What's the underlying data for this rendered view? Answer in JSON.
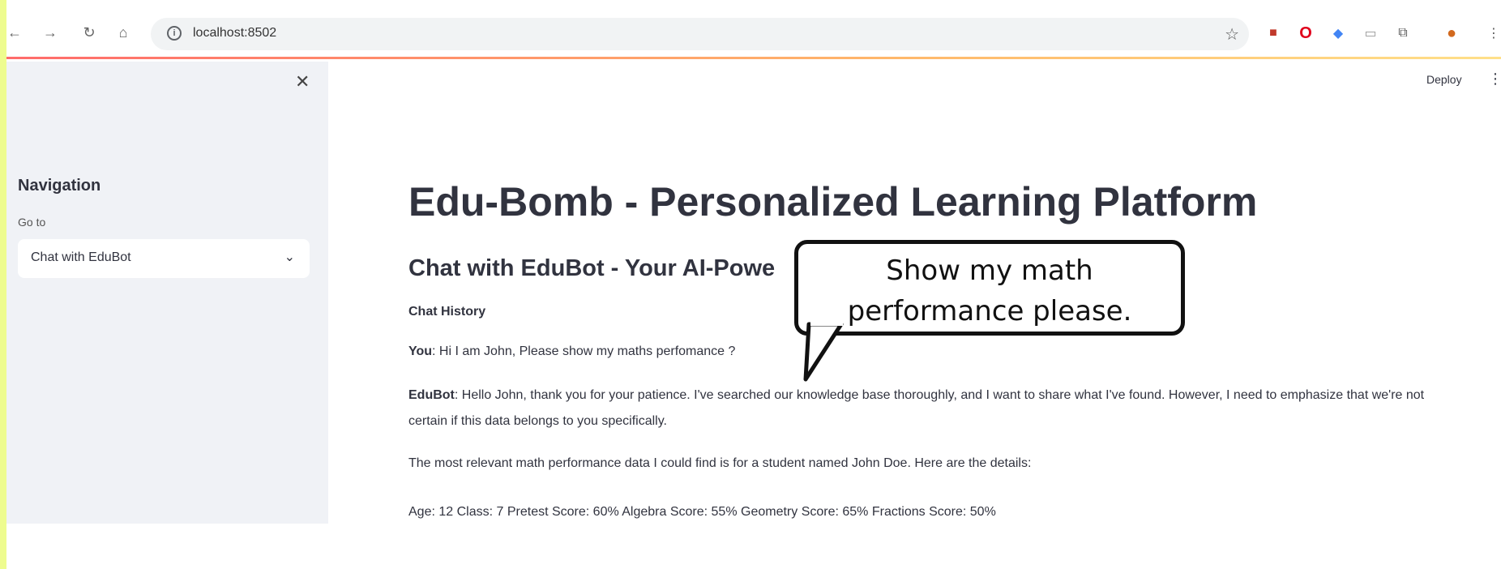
{
  "browser": {
    "url": "localhost:8502"
  },
  "sidebar": {
    "title": "Navigation",
    "goto_label": "Go to",
    "selected_page": "Chat with EduBot"
  },
  "header": {
    "deploy_label": "Deploy"
  },
  "main": {
    "title": "Edu-Bomb - Personalized Learning Platform",
    "subtitle": "Chat with EduBot - Your AI-Powe",
    "chat_history_label": "Chat History",
    "messages": [
      {
        "speaker": "You",
        "text": ": Hi I am John, Please show my maths perfomance ?"
      },
      {
        "speaker": "EduBot",
        "text": ": Hello John, thank you for your patience. I've searched our knowledge base thoroughly, and I want to share what I've found. However, I need to emphasize that we're not certain if this data belongs to you specifically."
      }
    ],
    "paragraph_3": "The most relevant math performance data I could find is for a student named John Doe. Here are the details:",
    "paragraph_4": "Age: 12 Class: 7 Pretest Score: 60% Algebra Score: 55% Geometry Score: 65% Fractions Score: 50%"
  },
  "callout": {
    "line_1": "Show my math",
    "line_2": "performance please."
  }
}
